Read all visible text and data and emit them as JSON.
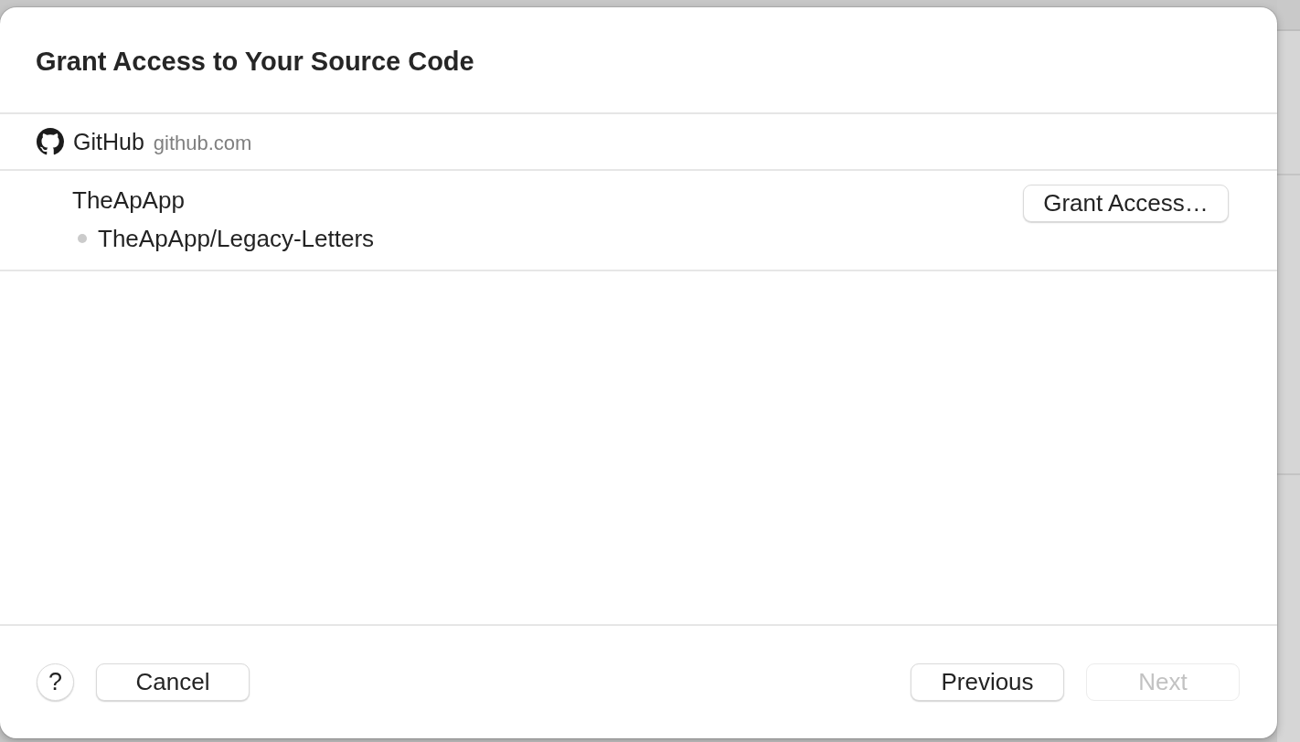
{
  "dialog": {
    "title": "Grant Access to Your Source Code"
  },
  "provider": {
    "name": "GitHub",
    "domain": "github.com"
  },
  "accounts": [
    {
      "name": "TheApApp",
      "action": {
        "label": "Grant Access…"
      },
      "repositories": [
        {
          "name": "TheApApp/Legacy-Letters"
        }
      ]
    }
  ],
  "footer": {
    "help": {
      "label": "?"
    },
    "left_buttons": [
      {
        "label": "Cancel",
        "disabled": false
      }
    ],
    "right_buttons": [
      {
        "label": "Previous",
        "disabled": false
      },
      {
        "label": "Next",
        "disabled": true
      }
    ]
  }
}
